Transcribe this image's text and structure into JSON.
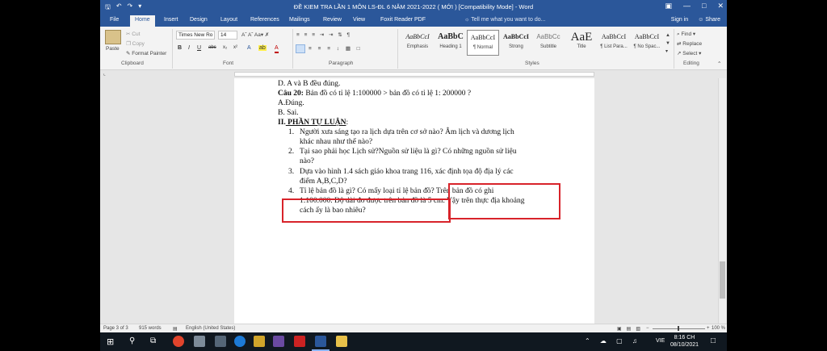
{
  "window": {
    "title": "ĐỀ KIEM TRA LẦN 1 MÔN LS-ĐL 6 NĂM 2021-2022 ( MỚI ) [Compatibility Mode] - Word",
    "qat_icons": [
      "save-icon",
      "undo-icon",
      "redo-icon",
      "customize-icon"
    ]
  },
  "tabs": [
    {
      "label": "File",
      "active": false
    },
    {
      "label": "Home",
      "active": true
    },
    {
      "label": "Insert",
      "active": false
    },
    {
      "label": "Design",
      "active": false
    },
    {
      "label": "Layout",
      "active": false
    },
    {
      "label": "References",
      "active": false
    },
    {
      "label": "Mailings",
      "active": false
    },
    {
      "label": "Review",
      "active": false
    },
    {
      "label": "View",
      "active": false
    },
    {
      "label": "Foxit Reader PDF",
      "active": false
    }
  ],
  "tell_me": "Tell me what you want to do...",
  "account": {
    "sign_in": "Sign in",
    "share": "Share"
  },
  "clipboard": {
    "paste": "Paste",
    "cut": "Cut",
    "copy": "Copy",
    "format_painter": "Format Painter",
    "label": "Clipboard"
  },
  "font": {
    "family": "Times New Ro",
    "size": "14",
    "buttons": [
      "B",
      "I",
      "U",
      "abc",
      "x₂",
      "x²"
    ],
    "label": "Font"
  },
  "paragraph": {
    "label": "Paragraph"
  },
  "styles": {
    "label": "Styles",
    "items": [
      {
        "preview": "AaBbCcI",
        "name": "Emphasis",
        "selected": false
      },
      {
        "preview": "AaBbC",
        "name": "Heading 1",
        "selected": false
      },
      {
        "preview": "AaBbCcI",
        "name": "¶ Normal",
        "selected": true
      },
      {
        "preview": "AaBbCcI",
        "name": "Strong",
        "selected": false
      },
      {
        "preview": "AaBbCc",
        "name": "Subtitle",
        "selected": false
      },
      {
        "preview": "AaE",
        "name": "Title",
        "selected": false
      },
      {
        "preview": "AaBbCcI",
        "name": "¶ List Para...",
        "selected": false
      },
      {
        "preview": "AaBbCcI",
        "name": "¶ No Spac...",
        "selected": false
      }
    ]
  },
  "editing": {
    "find": "Find",
    "replace": "Replace",
    "select": "Select",
    "label": "Editing"
  },
  "document": {
    "line_d": "D. A và B đều đúng.",
    "q20_label": "Câu 20:",
    "q20_text": " Bản đồ có tỉ lệ 1:100000 > bản đồ có tỉ lệ 1: 200000 ?",
    "opt_a": "A.Đúng.",
    "opt_b": "B. Sai.",
    "section_num": "II.",
    "section_title": " PHẦN TỰ LUẬN",
    "section_colon": ":",
    "items": [
      {
        "num": "1.",
        "lines": [
          "Người xưa sáng tạo ra lịch dựa trên cơ sở nào? Âm lịch và dương lịch",
          "khác nhau như thế nào?"
        ]
      },
      {
        "num": "2.",
        "lines": [
          "Tại sao phải  học Lịch sử?Nguồn sử liệu là gì? Có những nguồn sử liệu",
          "nào?"
        ]
      },
      {
        "num": "3.",
        "lines": [
          "Dựa vào hình 1.4 sách giáo khoa trang 116, xác định tọa độ địa lý các",
          "điểm A,B,C,D?"
        ]
      },
      {
        "num": "4.",
        "lines": [
          "Tỉ lệ bản đồ là gì? Có mấy loại tỉ lệ bản đồ? Trên bản đồ có ghi",
          "1:100.000. Độ dài đo được trên bản đồ là 5 cm. Vậy trên thực địa khoảng",
          "cách ấy là bao nhiêu?"
        ]
      }
    ]
  },
  "status": {
    "page": "Page 3 of 3",
    "words": "915 words",
    "language": "English (United States)",
    "zoom": "100 %"
  },
  "taskbar": {
    "time": "8:16 CH",
    "date": "08/10/2021",
    "lang": "VIE"
  }
}
